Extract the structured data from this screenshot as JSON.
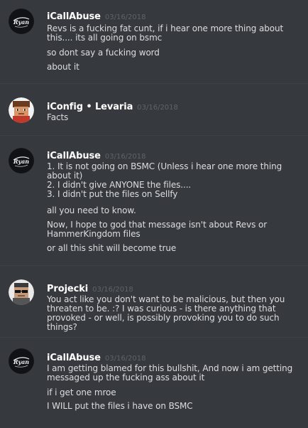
{
  "messages": [
    {
      "author": "iCallAbuse",
      "timestamp": "03/16/2018",
      "avatar_icon": "ryan-logo-avatar",
      "lines": [
        "Revs is a fucking fat cunt, if i hear one more thing about\nthis.... its all going on bsmc",
        "so dont say a fucking word",
        "about it"
      ]
    },
    {
      "author": "iConfig • Levaria",
      "timestamp": "03/16/2018",
      "avatar_icon": "pixel-character-avatar",
      "lines": [
        "Facts"
      ]
    },
    {
      "author": "iCallAbuse",
      "timestamp": "03/16/2018",
      "avatar_icon": "ryan-logo-avatar",
      "lines": [
        "1. It is not going on BSMC (Unless i hear one more thing\nabout it)\n2. I didn't give ANYONE the files....\n3. I didn't put the files on Sellfy",
        "all you need to know.",
        "Now, I hope to god that message isn't about Revs or\nHammerKingdom files",
        "or all this shit will become true"
      ]
    },
    {
      "author": "Projecki",
      "timestamp": "03/16/2018",
      "avatar_icon": "sunglasses-character-avatar",
      "lines": [
        "You act like you don't want to be malicious, but then you\nthreaten to be. :? I was curious - is there anything that\nprovoked - or well, is possibly provoking you to do such things?"
      ]
    },
    {
      "author": "iCallAbuse",
      "timestamp": "03/16/2018",
      "avatar_icon": "ryan-logo-avatar",
      "lines": [
        "I am getting blamed for this bullshit, And now i am getting\nmessaged up the fucking ass about it",
        "if i get one mroe",
        "I WILL put the files i have on BSMC"
      ]
    }
  ]
}
